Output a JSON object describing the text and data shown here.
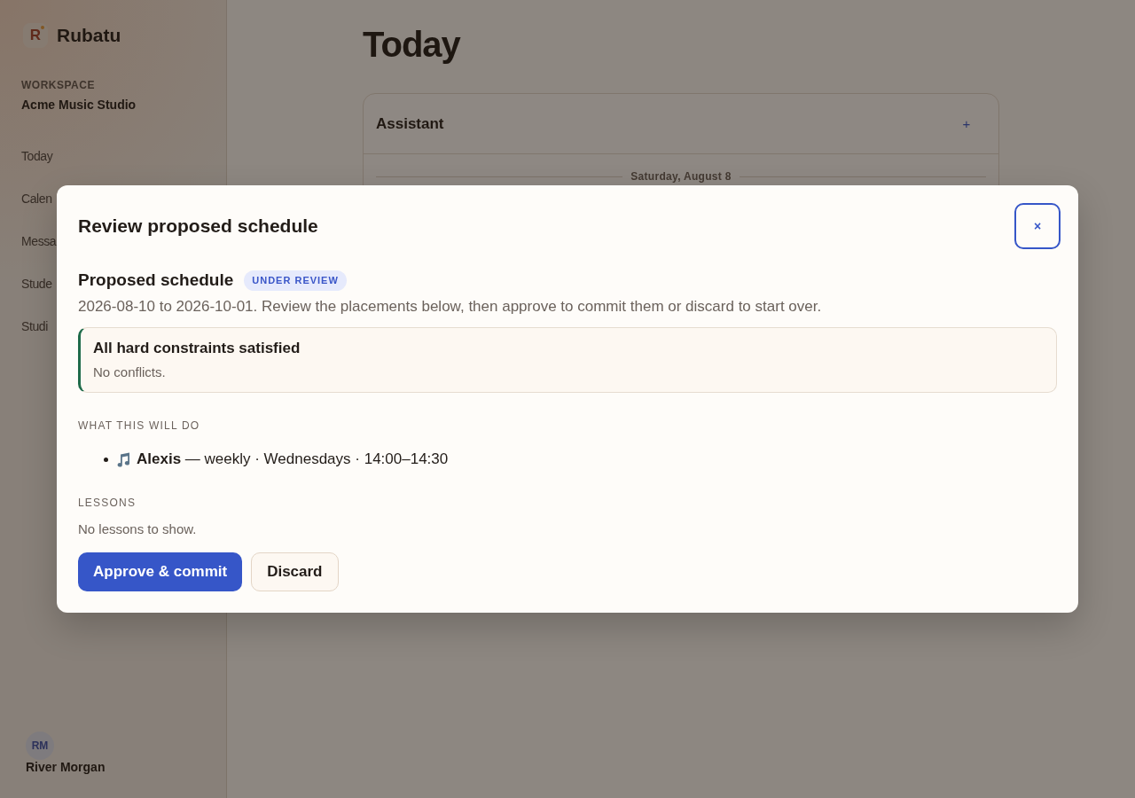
{
  "sidebar": {
    "brand": {
      "logo_letter": "R",
      "name": "Rubatu"
    },
    "workspace_label": "WORKSPACE",
    "workspace_name": "Acme Music Studio",
    "nav": [
      {
        "label": "Today"
      },
      {
        "label": "Calen"
      },
      {
        "label": "Messa"
      },
      {
        "label": "Stude"
      },
      {
        "label": "Studi"
      }
    ],
    "user": {
      "initials": "RM",
      "name": "River Morgan"
    }
  },
  "page": {
    "title": "Today",
    "assistant": {
      "title": "Assistant",
      "add_label": "+",
      "date_divider": "Saturday, August 8"
    }
  },
  "dialog": {
    "title": "Review proposed schedule",
    "close_label": "×",
    "proposal": {
      "heading": "Proposed schedule",
      "status": "UNDER REVIEW",
      "description": "2026-08-10 to 2026-10-01. Review the placements below, then approve to commit them or discard to start over."
    },
    "check": {
      "kind": "success",
      "title": "All hard constraints satisfied",
      "detail": "No conflicts."
    },
    "actions_heading": "WHAT THIS WILL DO",
    "actions": [
      {
        "kind": "lesson",
        "text": "**Alexis** — weekly · Wednesdays · 14:00–14:30"
      }
    ],
    "lessons_heading": "LESSONS",
    "lessons_empty": "No lessons to show.",
    "buttons": [
      {
        "kind": "primary",
        "label": "Approve & commit"
      },
      {
        "kind": "secondary",
        "label": "Discard"
      }
    ]
  }
}
